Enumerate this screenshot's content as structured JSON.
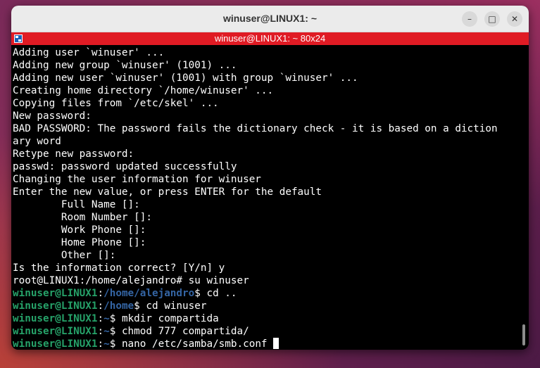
{
  "window": {
    "title": "winuser@LINUX1: ~",
    "tab_title": "winuser@LINUX1: ~ 80x24",
    "buttons": {
      "minimize": "–",
      "maximize": "□",
      "close": "✕"
    }
  },
  "colors": {
    "titlebar": "#ebebeb",
    "tabbar": "#e01b24",
    "terminal_bg": "#000000",
    "prompt_user": "#26a269",
    "prompt_path": "#3465a4"
  },
  "icons": {
    "terminal_tab": "terminal-icon",
    "minimize": "minimize-icon",
    "maximize": "maximize-icon",
    "close": "close-icon"
  },
  "terminal": {
    "output": [
      "Adding user `winuser' ...",
      "Adding new group `winuser' (1001) ...",
      "Adding new user `winuser' (1001) with group `winuser' ...",
      "Creating home directory `/home/winuser' ...",
      "Copying files from `/etc/skel' ...",
      "New password:",
      "BAD PASSWORD: The password fails the dictionary check - it is based on a diction",
      "ary word",
      "Retype new password:",
      "passwd: password updated successfully",
      "Changing the user information for winuser",
      "Enter the new value, or press ENTER for the default",
      "        Full Name []:",
      "        Room Number []:",
      "        Work Phone []:",
      "        Home Phone []:",
      "        Other []:",
      "Is the information correct? [Y/n] y",
      "root@LINUX1:/home/alejandro# su winuser"
    ],
    "prompts": [
      {
        "user": "winuser@LINUX1",
        "sep": ":",
        "path": "/home/alejandro",
        "sign": "$",
        "cmd": " cd .."
      },
      {
        "user": "winuser@LINUX1",
        "sep": ":",
        "path": "/home",
        "sign": "$",
        "cmd": " cd winuser"
      },
      {
        "user": "winuser@LINUX1",
        "sep": ":",
        "path": "~",
        "sign": "$",
        "cmd": " mkdir compartida"
      },
      {
        "user": "winuser@LINUX1",
        "sep": ":",
        "path": "~",
        "sign": "$",
        "cmd": " chmod 777 compartida/"
      },
      {
        "user": "winuser@LINUX1",
        "sep": ":",
        "path": "~",
        "sign": "$",
        "cmd": " nano /etc/samba/smb.conf "
      }
    ]
  }
}
